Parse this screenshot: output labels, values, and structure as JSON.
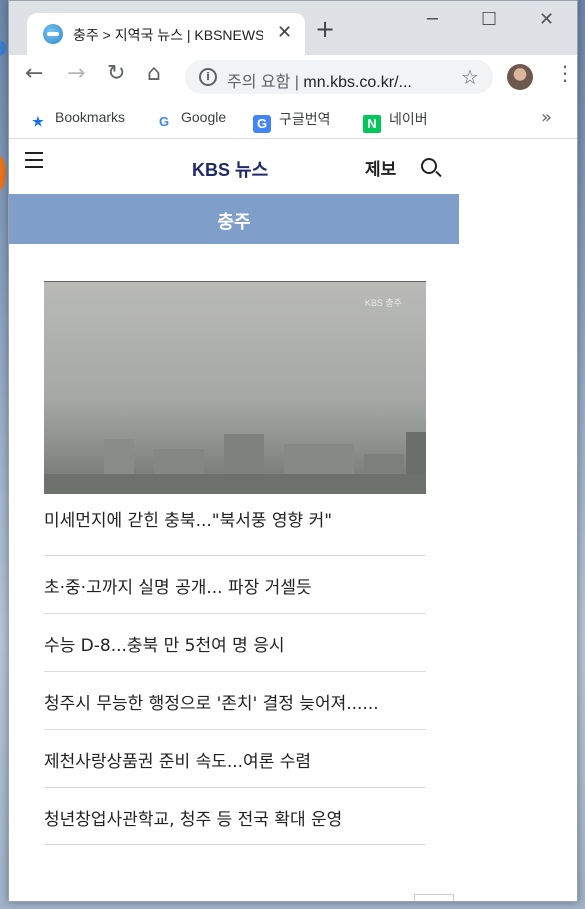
{
  "browser": {
    "tab_title": "충주 > 지역국 뉴스 | KBSNEWS",
    "tab_close": "✕",
    "new_tab": "+",
    "window_controls": {
      "minimize": "─",
      "maximize": "☐",
      "close": "✕"
    },
    "nav": {
      "back": "←",
      "forward": "→",
      "reload": "↻",
      "home": "⌂"
    },
    "omnibox": {
      "warning": "주의 요함",
      "separator": "|",
      "url": "mn.kbs.co.kr/..."
    },
    "star": "☆",
    "menu": "⋮",
    "bookmarks": [
      {
        "label": "Bookmarks",
        "icon": "star-icon",
        "glyph": "★",
        "color": "#1a73e8"
      },
      {
        "label": "Google",
        "icon": "google-icon",
        "glyph": "G",
        "color": "#4285f4"
      },
      {
        "label": "구글번역",
        "icon": "translate-icon",
        "glyph": "G",
        "color": "#4285f4"
      },
      {
        "label": "네이버",
        "icon": "naver-icon",
        "glyph": "N",
        "color": "#03c75a"
      }
    ],
    "bookmarks_more": "»"
  },
  "site": {
    "logo": "KBS 뉴스",
    "report_label": "제보",
    "region_title": "충주",
    "photo_watermark": "KBS 충주",
    "headline_main": "미세먼지에 갇힌 충북...\"북서풍 영향 커\"",
    "news_items": [
      "초·중·고까지 실명 공개... 파장 거셀듯",
      "수능 D-8...충북 만 5천여 명 응시",
      "청주시 무능한 행정으로 '존치' 결정 늦어져......",
      "제천사랑상품권 준비 속도...여론 수렴",
      "청년창업사관학교, 청주 등 전국 확대 운영"
    ]
  },
  "colors": {
    "region_bar": "#7f9ec9",
    "logo": "#1e2a6b",
    "tab_strip": "#dee1e6"
  }
}
